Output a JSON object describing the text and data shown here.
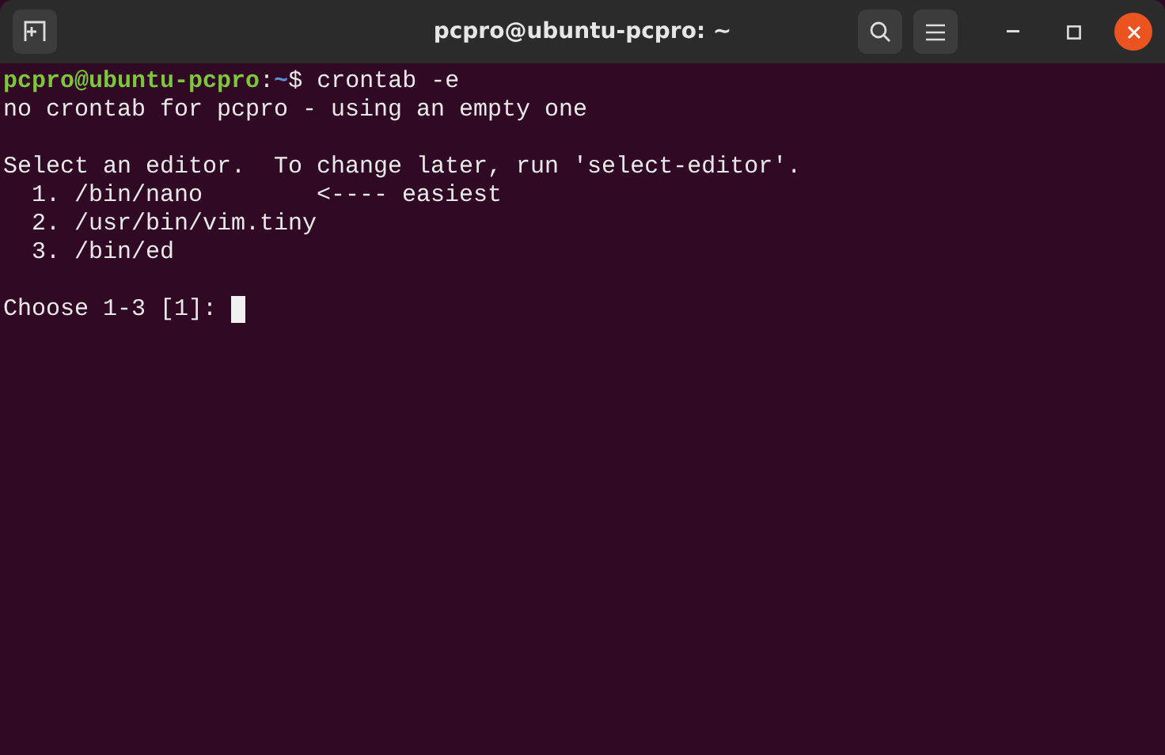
{
  "window": {
    "title": "pcpro@ubuntu-pcpro: ~"
  },
  "terminal": {
    "lines": [
      {
        "kind": "prompt",
        "user_host": "pcpro@ubuntu-pcpro",
        "separator": ":",
        "path": "~",
        "command": "$ crontab -e"
      },
      {
        "kind": "output",
        "text": "no crontab for pcpro - using an empty one"
      },
      {
        "kind": "blank"
      },
      {
        "kind": "output",
        "text": "Select an editor.  To change later, run 'select-editor'."
      },
      {
        "kind": "output",
        "text": "  1. /bin/nano        <---- easiest"
      },
      {
        "kind": "output",
        "text": "  2. /usr/bin/vim.tiny"
      },
      {
        "kind": "output",
        "text": "  3. /bin/ed"
      },
      {
        "kind": "blank"
      },
      {
        "kind": "input",
        "text": "Choose 1-3 [1]:",
        "cursor": true
      }
    ]
  }
}
